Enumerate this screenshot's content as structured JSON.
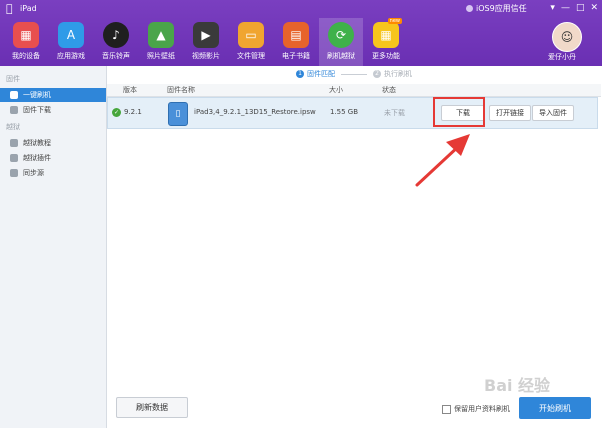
{
  "app": {
    "title": "iPad",
    "trust_label": "iOS9应用信任",
    "window_controls": [
      "▾",
      "—",
      "□",
      "✕"
    ],
    "user_name": "爱仔小丹"
  },
  "nav": [
    {
      "label": "我的设备",
      "icon": "my-device-icon",
      "color": "#e84f4f"
    },
    {
      "label": "应用游戏",
      "icon": "app-store-icon",
      "color": "#2f9be8"
    },
    {
      "label": "音乐铃声",
      "icon": "music-icon",
      "color": "#1f1f1f"
    },
    {
      "label": "照片壁纸",
      "icon": "photo-icon",
      "color": "#4aa54a"
    },
    {
      "label": "视频影片",
      "icon": "video-icon",
      "color": "#3a3a3a"
    },
    {
      "label": "文件管理",
      "icon": "folder-icon",
      "color": "#f0a530"
    },
    {
      "label": "电子书籍",
      "icon": "book-icon",
      "color": "#e7632b"
    },
    {
      "label": "刷机越狱",
      "icon": "flash-icon",
      "color": "#3fb14a",
      "active": true
    },
    {
      "label": "更多功能",
      "icon": "more-icon",
      "color": "#f7c51c",
      "badge": "new"
    }
  ],
  "sidebar": {
    "section1": "固件",
    "items1": [
      {
        "label": "一键刷机",
        "active": true
      },
      {
        "label": "固件下载"
      }
    ],
    "section2": "越狱",
    "items2": [
      {
        "label": "越狱教程"
      },
      {
        "label": "越狱插件"
      },
      {
        "label": "同步源"
      }
    ]
  },
  "steps": [
    {
      "num": "1",
      "label": "固件匹配",
      "active": true
    },
    {
      "num": "2",
      "label": "执行刷机",
      "active": false
    }
  ],
  "table": {
    "headers": [
      "版本",
      "固件名称",
      "大小",
      "状态"
    ],
    "rows": [
      {
        "version": "9.2.1",
        "name": "iPad3,4_9.2.1_13D15_Restore.ipsw",
        "size": "1.55 GB",
        "status": "未下载",
        "actions": [
          "下载",
          "打开链接",
          "导入固件"
        ]
      }
    ]
  },
  "bottom": {
    "refresh": "刷新数据",
    "keep_data": "保留用户资料刷机",
    "start": "开始刷机"
  },
  "watermark": "Bai 经验",
  "colors": {
    "brand_purple": "#6a2fb3",
    "accent_blue": "#2f86d9",
    "highlight_red": "#e53935",
    "success_green": "#46a63c"
  }
}
